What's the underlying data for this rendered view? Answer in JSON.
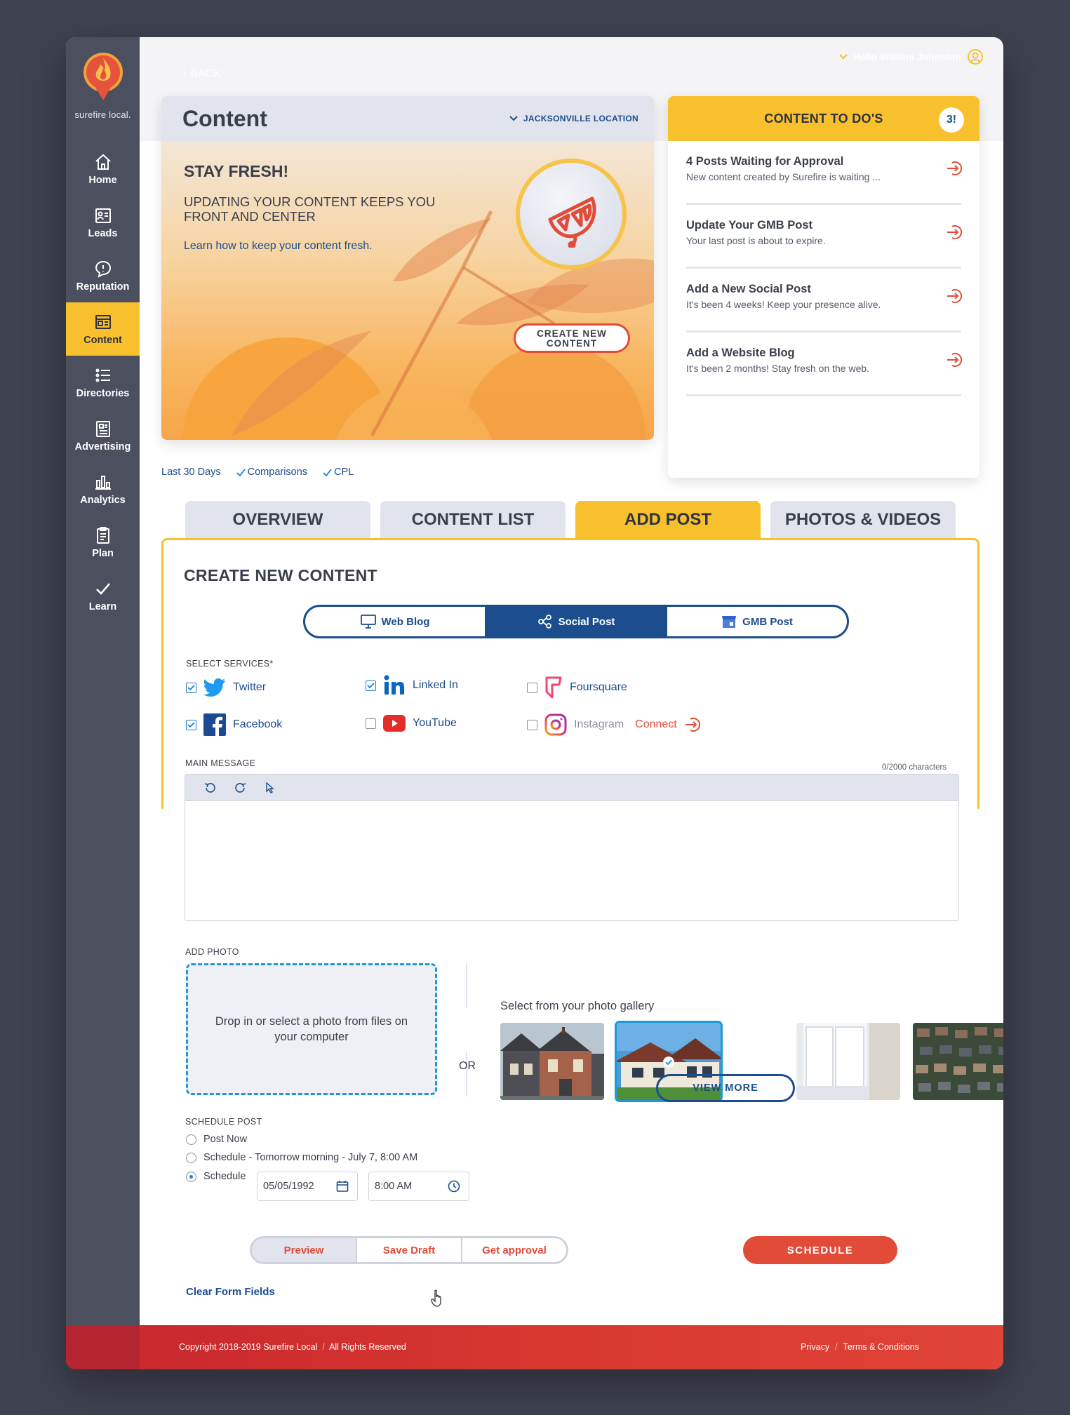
{
  "brand": {
    "logo_text": "surefire local."
  },
  "header": {
    "back_label": "BACK",
    "greeting": "Hello William Johnston"
  },
  "sidebar": {
    "items": [
      {
        "label": "Home",
        "icon": "home-icon"
      },
      {
        "label": "Leads",
        "icon": "leads-icon"
      },
      {
        "label": "Reputation",
        "icon": "reputation-icon"
      },
      {
        "label": "Content",
        "icon": "content-icon",
        "active": true
      },
      {
        "label": "Directories",
        "icon": "directories-icon"
      },
      {
        "label": "Advertising",
        "icon": "advertising-icon"
      },
      {
        "label": "Analytics",
        "icon": "analytics-icon"
      },
      {
        "label": "Plan",
        "icon": "plan-icon"
      },
      {
        "label": "Learn",
        "icon": "learn-icon"
      }
    ]
  },
  "hero": {
    "title": "Content",
    "location": "JACKSONVILLE LOCATION",
    "headline": "STAY FRESH!",
    "subheadline": "UPDATING YOUR CONTENT KEEPS YOU FRONT AND CENTER",
    "link": "Learn how to keep your content fresh.",
    "cta": "CREATE NEW CONTENT"
  },
  "todos": {
    "title": "CONTENT TO DO'S",
    "count": "3!",
    "items": [
      {
        "title": "4 Posts Waiting for Approval",
        "desc": "New content created by Surefire is waiting ..."
      },
      {
        "title": "Update Your GMB Post",
        "desc": "Your last post is about to expire."
      },
      {
        "title": "Add a New Social Post",
        "desc": "It's been 4 weeks! Keep your presence alive."
      },
      {
        "title": "Add a Website Blog",
        "desc": "It's been 2 months! Stay fresh on the web."
      }
    ]
  },
  "filters": {
    "range": "Last 30 Days",
    "comparisons": "Comparisons",
    "cpl": "CPL"
  },
  "tabs": [
    {
      "label": "OVERVIEW"
    },
    {
      "label": "CONTENT LIST"
    },
    {
      "label": "ADD POST",
      "active": true
    },
    {
      "label": "PHOTOS & VIDEOS"
    }
  ],
  "create": {
    "title": "CREATE NEW CONTENT",
    "types": [
      {
        "label": "Web Blog",
        "icon": "monitor-icon"
      },
      {
        "label": "Social Post",
        "icon": "share-icon",
        "active": true
      },
      {
        "label": "GMB Post",
        "icon": "store-icon"
      }
    ],
    "services_label": "SELECT SERVICES*",
    "services": [
      {
        "name": "Twitter",
        "checked": true
      },
      {
        "name": "Linked In",
        "checked": true
      },
      {
        "name": "Foursquare",
        "checked": false
      },
      {
        "name": "Facebook",
        "checked": true
      },
      {
        "name": "YouTube",
        "checked": false
      },
      {
        "name": "Instagram",
        "checked": false,
        "action": "Connect"
      }
    ],
    "message_label": "MAIN MESSAGE",
    "char_count": "0/2000 characters",
    "add_photo_label": "ADD PHOTO",
    "drop_text": "Drop in or select a photo from files on your computer",
    "or": "OR",
    "gallery_title": "Select from your photo gallery",
    "view_more": "VIEW MORE",
    "schedule_label": "SCHEDULE POST",
    "schedule_options": [
      {
        "label": "Post Now",
        "selected": false
      },
      {
        "label": "Schedule - Tomorrow morning - July 7, 8:00 AM",
        "selected": false
      },
      {
        "label": "Schedule",
        "selected": true
      }
    ],
    "date_value": "05/05/1992",
    "time_value": "8:00 AM",
    "actions": [
      {
        "label": "Preview",
        "active": true
      },
      {
        "label": "Save Draft"
      },
      {
        "label": "Get approval"
      }
    ],
    "schedule_button": "SCHEDULE",
    "clear_label": "Clear Form Fields"
  },
  "footer": {
    "copyright": "Copyright 2018-2019 Surefire Local",
    "rights": "All Rights Reserved",
    "privacy": "Privacy",
    "terms": "Terms & Conditions"
  },
  "colors": {
    "accent": "#f9c02d",
    "brand_blue": "#1c4d8c",
    "brand_red": "#e14b38",
    "sidebar": "#4c4f5e"
  }
}
